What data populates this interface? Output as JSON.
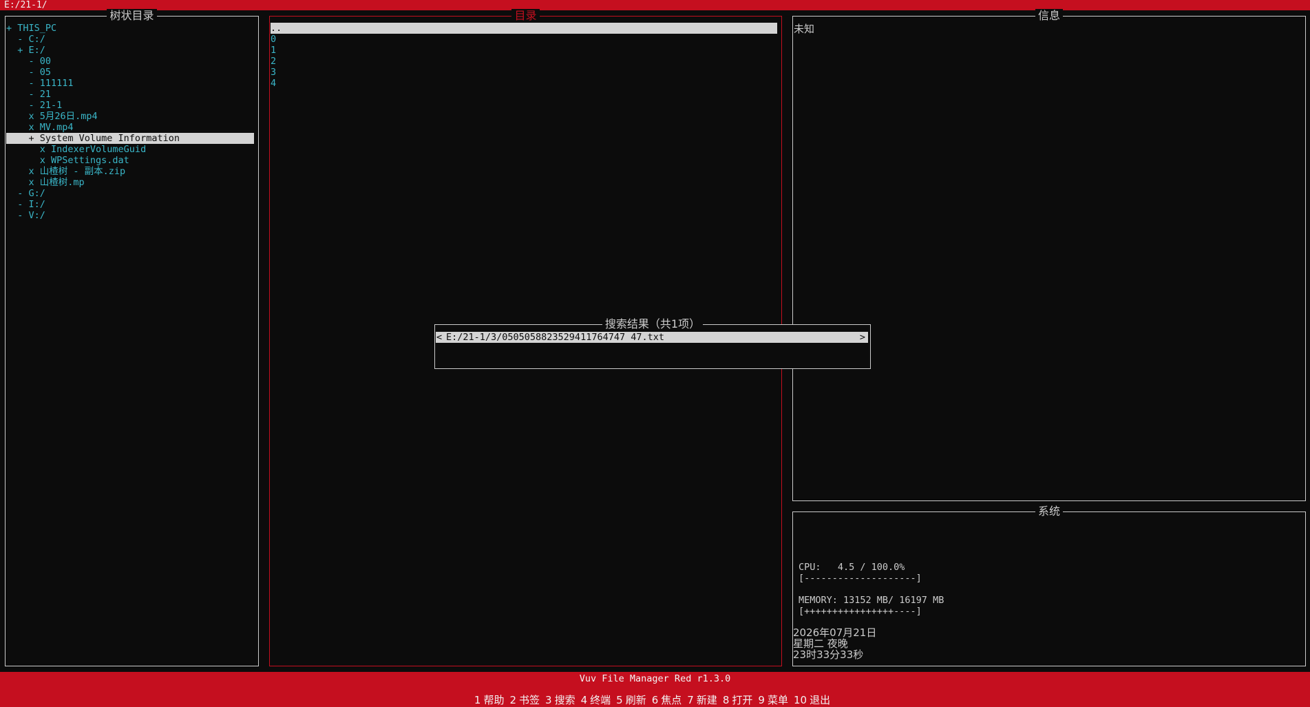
{
  "path_bar": "E:/21-1/",
  "tree_panel": {
    "title": "树状目录",
    "items": [
      {
        "text": "+ THIS_PC",
        "selected": false
      },
      {
        "text": "  - C:/",
        "selected": false
      },
      {
        "text": "  + E:/",
        "selected": false
      },
      {
        "text": "    - 00",
        "selected": false
      },
      {
        "text": "    - 05",
        "selected": false
      },
      {
        "text": "    - 111111",
        "selected": false
      },
      {
        "text": "    - 21",
        "selected": false
      },
      {
        "text": "    - 21-1",
        "selected": false
      },
      {
        "text": "    x 5月26日.mp4",
        "selected": false
      },
      {
        "text": "    x MV.mp4",
        "selected": false
      },
      {
        "text": "    + System Volume Information",
        "selected": true
      },
      {
        "text": "      x IndexerVolumeGuid",
        "selected": false
      },
      {
        "text": "      x WPSettings.dat",
        "selected": false
      },
      {
        "text": "    x 山楂树 - 副本.zip",
        "selected": false
      },
      {
        "text": "    x 山楂树.mp",
        "selected": false
      },
      {
        "text": "  - G:/",
        "selected": false
      },
      {
        "text": "  - I:/",
        "selected": false
      },
      {
        "text": "  - V:/",
        "selected": false
      }
    ]
  },
  "dir_panel": {
    "title": "目录",
    "items": [
      {
        "text": "..",
        "selected": true
      },
      {
        "text": "0",
        "selected": false
      },
      {
        "text": "1",
        "selected": false
      },
      {
        "text": "2",
        "selected": false
      },
      {
        "text": "3",
        "selected": false
      },
      {
        "text": "4",
        "selected": false
      }
    ]
  },
  "info_panel": {
    "title": "信息",
    "text": "未知"
  },
  "system_panel": {
    "title": "系统",
    "cpu_line": "CPU:   4.5 / 100.0%",
    "cpu_bar": "[--------------------]",
    "memory_line": "MEMORY: 13152 MB/ 16197 MB",
    "memory_bar": "[++++++++++++++++----]",
    "date": "2026年07月21日",
    "weekday": "星期二 夜晚",
    "time": "23时33分33秒"
  },
  "search_popup": {
    "title": "搜索结果（共1项）",
    "result": "E:/21-1/3/0505058823529411764747 47.txt",
    "left_arrow": "<",
    "right_arrow": ">"
  },
  "bottom_bar": {
    "title": "Vuv File Manager Red r1.3.0",
    "fkeys": [
      {
        "num": "1",
        "label": "帮助"
      },
      {
        "num": "2",
        "label": "书签"
      },
      {
        "num": "3",
        "label": "搜索"
      },
      {
        "num": "4",
        "label": "终端"
      },
      {
        "num": "5",
        "label": "刷新"
      },
      {
        "num": "6",
        "label": "焦点"
      },
      {
        "num": "7",
        "label": "新建"
      },
      {
        "num": "8",
        "label": "打开"
      },
      {
        "num": "9",
        "label": "菜单"
      },
      {
        "num": "10",
        "label": "退出"
      }
    ]
  },
  "colors": {
    "accent_red": "#c50f1f",
    "tree_text": "#3ab6c8",
    "background": "#0c0c0c",
    "selection": "#d4d4d4"
  }
}
